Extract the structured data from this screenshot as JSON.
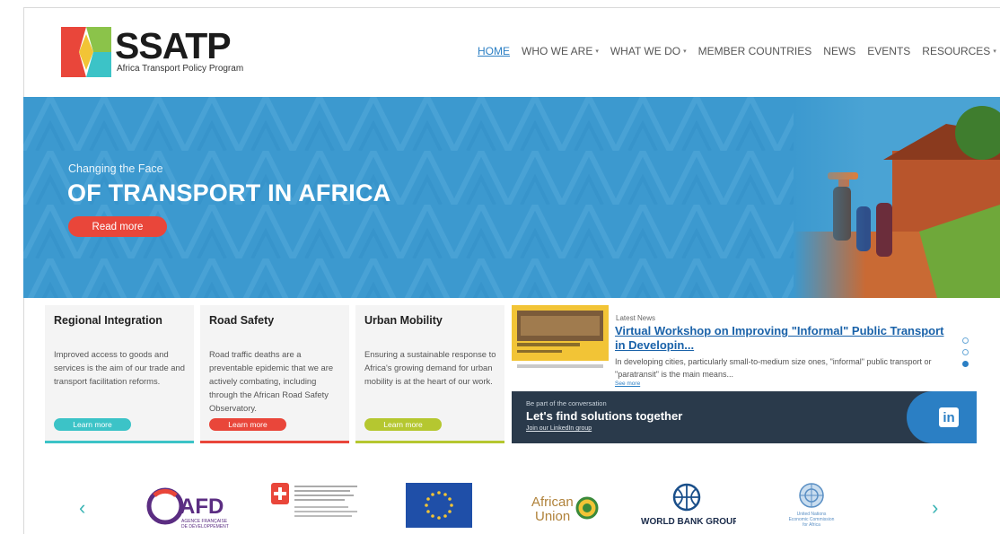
{
  "brand": {
    "name": "SSATP",
    "tagline": "Africa Transport Policy Program"
  },
  "nav": {
    "items": [
      {
        "label": "HOME",
        "active": true,
        "dropdown": false
      },
      {
        "label": "WHO WE ARE",
        "active": false,
        "dropdown": true
      },
      {
        "label": "WHAT WE DO",
        "active": false,
        "dropdown": true
      },
      {
        "label": "MEMBER COUNTRIES",
        "active": false,
        "dropdown": false
      },
      {
        "label": "NEWS",
        "active": false,
        "dropdown": false
      },
      {
        "label": "EVENTS",
        "active": false,
        "dropdown": false
      },
      {
        "label": "RESOURCES",
        "active": false,
        "dropdown": true
      }
    ],
    "caret": "▾"
  },
  "hero": {
    "kicker": "Changing the Face",
    "title": "OF TRANSPORT IN AFRICA",
    "button": "Read more"
  },
  "cards": [
    {
      "title": "Regional Integration",
      "text": "Improved access to goods and services is the aim of our trade and transport facilitation reforms.",
      "button": "Learn more",
      "color": "#3cc3c7"
    },
    {
      "title": "Road Safety",
      "text": "Road traffic deaths are a preventable epidemic that we are actively combating, including through the African Road Safety Observatory.",
      "button": "Learn more",
      "color": "#e9463a"
    },
    {
      "title": "Urban Mobility",
      "text": "Ensuring a sustainable response to Africa's growing demand for urban mobility is at the heart of our work.",
      "button": "Learn more",
      "color": "#b5c730"
    }
  ],
  "news": {
    "label": "Latest News",
    "title": "Virtual Workshop on Improving \"Informal\" Public Transport in Developin...",
    "excerpt": "In developing cities, particularly small-to-medium size ones, \"informal\" public transport or \"paratransit\" is the main means...",
    "more": "See more",
    "slide_count": 3,
    "active_slide": 3
  },
  "linkedin": {
    "kicker": "Be part of the conversation",
    "title": "Let's find solutions together",
    "link": "Join our LinkedIn group",
    "logo": "in"
  },
  "partners": {
    "prev": "‹",
    "next": "›",
    "items": [
      {
        "name": "AFD",
        "sub1": "AGENCE FRANÇAISE",
        "sub2": "DE DÉVELOPPEMENT"
      },
      {
        "name": "Swiss Confederation"
      },
      {
        "name": "European Union"
      },
      {
        "name": "African Union",
        "line1": "African",
        "line2": "Union"
      },
      {
        "name": "WORLD BANK GROUP"
      },
      {
        "name": "United Nations Economic Commission for Africa",
        "line1": "United Nations",
        "line2": "Economic Commission",
        "line3": "for Africa"
      }
    ]
  },
  "colors": {
    "accent": "#2b7fc4",
    "hero_bg": "#3c99cf",
    "cta_red": "#e9463a",
    "linkedin_bg": "#2a3a4b"
  }
}
